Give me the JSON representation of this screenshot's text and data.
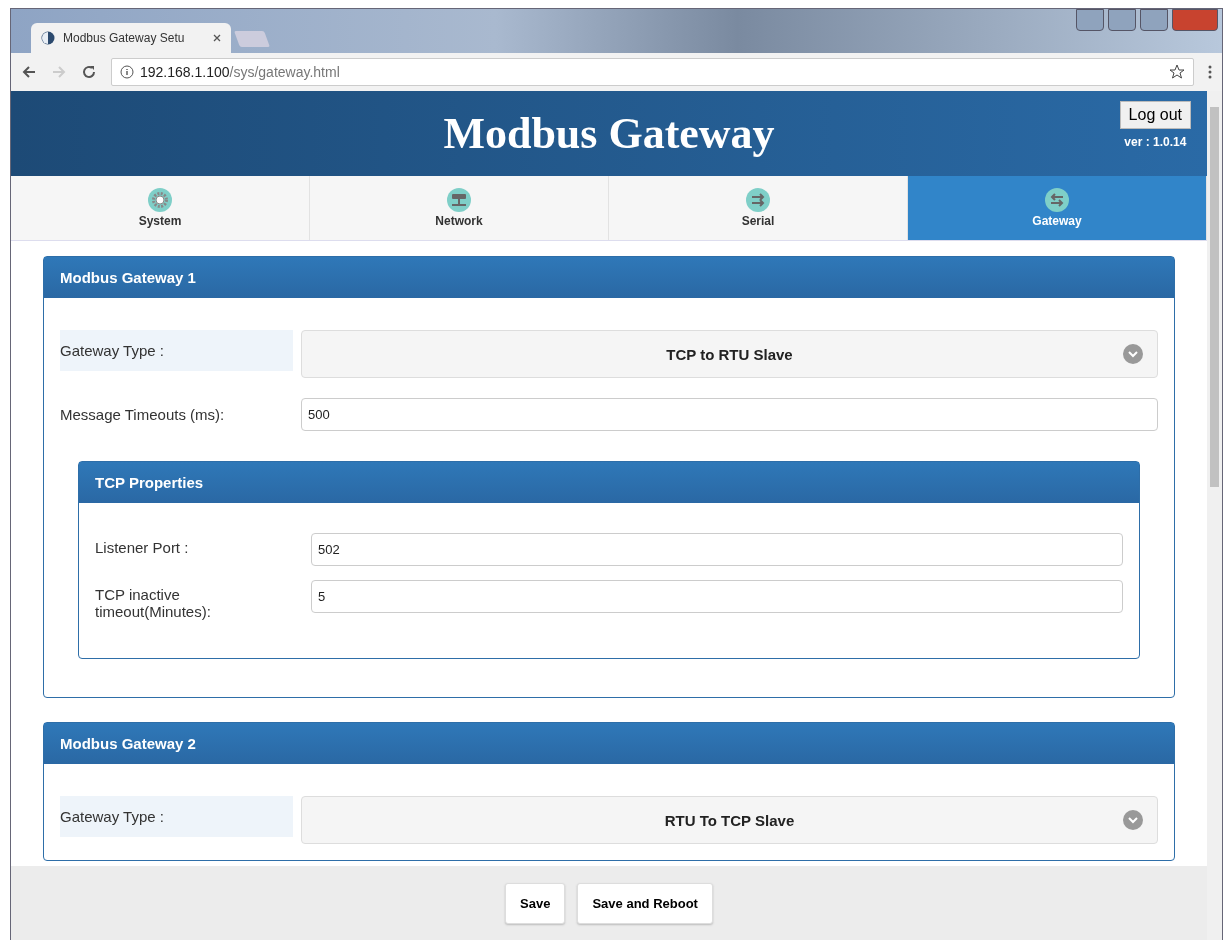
{
  "browser": {
    "tab_title": "Modbus Gateway Setu",
    "url_host": "192.168.1.100",
    "url_path": "/sys/gateway.html"
  },
  "header": {
    "title": "Modbus Gateway",
    "logout": "Log out",
    "version": "ver : 1.0.14"
  },
  "nav": [
    {
      "label": "System",
      "kind": "gear",
      "selected": false
    },
    {
      "label": "Network",
      "kind": "network",
      "selected": false
    },
    {
      "label": "Serial",
      "kind": "serial",
      "selected": false
    },
    {
      "label": "Gateway",
      "kind": "gateway",
      "selected": true
    }
  ],
  "gateways": [
    {
      "title": "Modbus Gateway 1",
      "fields": [
        {
          "kind": "select",
          "label": "Gateway Type :",
          "value": "TCP to RTU Slave"
        },
        {
          "kind": "input",
          "label": "Message Timeouts (ms):",
          "value": "500"
        }
      ],
      "tcp": {
        "title": "TCP Properties",
        "fields": [
          {
            "kind": "input",
            "label": "Listener Port :",
            "value": "502"
          },
          {
            "kind": "input",
            "label": "TCP inactive timeout(Minutes):",
            "value": "5"
          }
        ]
      }
    },
    {
      "title": "Modbus Gateway 2",
      "fields": [
        {
          "kind": "select",
          "label": "Gateway Type :",
          "value": "RTU To TCP Slave"
        }
      ]
    }
  ],
  "footer": {
    "buttons": [
      "Save",
      "Save and Reboot"
    ]
  }
}
